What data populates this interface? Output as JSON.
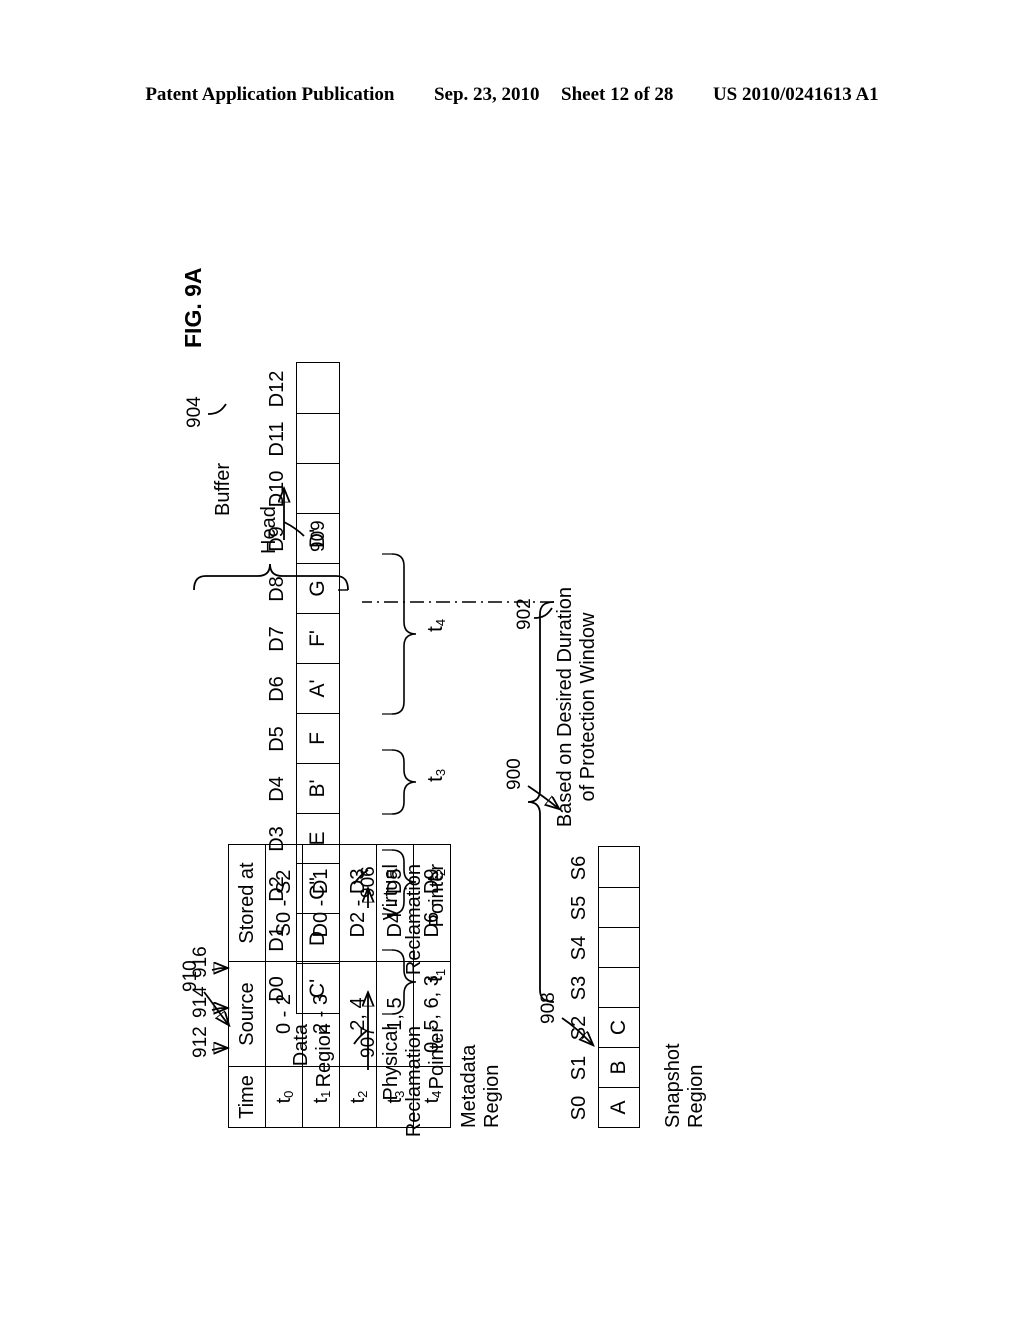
{
  "header": {
    "publication": "Patent Application Publication",
    "date": "Sep. 23, 2010",
    "sheet": "Sheet 12 of 28",
    "patent_number": "US 2010/0241613 A1"
  },
  "figure": {
    "caption": "FIG. 9A",
    "system_ref": "900"
  },
  "metadata_region": {
    "label": "Metadata\nRegion",
    "label_line1": "Metadata",
    "label_line2": "Region",
    "ref": "910",
    "columns": [
      "Time",
      "Source",
      "Stored at"
    ],
    "rows": [
      {
        "time": "t",
        "time_sub": "0",
        "source": "0 - 2",
        "stored_at": "S0 - S2",
        "ref": "912"
      },
      {
        "time": "t",
        "time_sub": "1",
        "source": "2 - 3",
        "stored_at": "D0 - D1",
        "ref": "914"
      },
      {
        "time": "t",
        "time_sub": "2",
        "source": "2, 4",
        "stored_at": "D2 - D3",
        "ref": "916"
      },
      {
        "time": "t",
        "time_sub": "3",
        "source": "1, 5",
        "stored_at": "D4 - D5",
        "ref": ""
      },
      {
        "time": "t",
        "time_sub": "4",
        "source": "0, 5, 6, 3",
        "stored_at": "D6 - D9",
        "ref": ""
      }
    ]
  },
  "snapshot_region": {
    "label_line1": "Snapshot",
    "label_line2": "Region",
    "ref": "908",
    "slot_labels": [
      "S0",
      "S1",
      "S2",
      "S3",
      "S4",
      "S5",
      "S6"
    ],
    "slot_values": [
      "A",
      "B",
      "C",
      "",
      "",
      "",
      ""
    ]
  },
  "data_region": {
    "label_line1": "Data",
    "label_line2": "Region",
    "slot_labels": [
      "D0",
      "D1",
      "D2",
      "D3",
      "D4",
      "D5",
      "D6",
      "D7",
      "D8",
      "D9",
      "D10",
      "D11",
      "D12"
    ],
    "slot_values": [
      "C'",
      "D",
      "C\"",
      "E",
      "B'",
      "F",
      "A'",
      "F'",
      "G",
      "D'",
      "",
      "",
      ""
    ]
  },
  "time_brackets": [
    {
      "label": "t",
      "sub": "1",
      "span": "D0 - D1"
    },
    {
      "label": "t",
      "sub": "2",
      "span": "D2 - D3"
    },
    {
      "label": "t",
      "sub": "3",
      "span": "D4 - D5"
    },
    {
      "label": "t",
      "sub": "4",
      "span": "D6 - D9"
    }
  ],
  "annotations": {
    "protection_window_line1": "Based on Desired Duration",
    "protection_window_line2": "of Protection Window",
    "protection_window_ref": "902",
    "buffer_label": "Buffer",
    "buffer_ref": "904",
    "head_label": "Head",
    "head_ref": "909",
    "physical_pointer_line1": "Physical",
    "physical_pointer_line2": "Reclamation",
    "physical_pointer_line3": "Pointer",
    "physical_pointer_ref": "907",
    "virtual_pointer_line1": "Virtual",
    "virtual_pointer_line2": "Reclamation",
    "virtual_pointer_line3": "Pointer",
    "virtual_pointer_ref": "906"
  }
}
